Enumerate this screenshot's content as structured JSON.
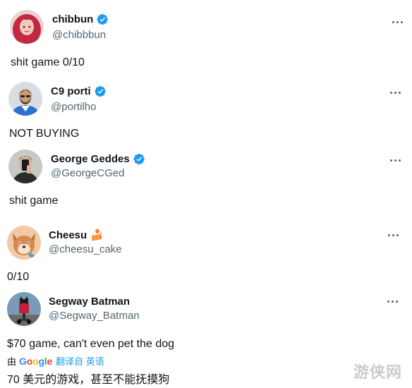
{
  "tweets": [
    {
      "name": "chibbun",
      "handle": "@chibbbun",
      "verified": true,
      "text": "shit game 0/10",
      "avatar_icon": "avatar-pink-hair"
    },
    {
      "name": "C9 porti",
      "handle": "@portilho",
      "verified": true,
      "text": "NOT BUYING",
      "avatar_icon": "avatar-man-jersey"
    },
    {
      "name": "George Geddes",
      "handle": "@GeorgeCGed",
      "verified": true,
      "text": "shit game",
      "avatar_icon": "avatar-mirror-selfie"
    },
    {
      "name": "Cheesu",
      "handle": "@cheesu_cake",
      "verified": false,
      "emoji": "🍰",
      "text": "0/10",
      "avatar_icon": "avatar-cartoon-dog"
    },
    {
      "name": "Segway Batman",
      "handle": "@Segway_Batman",
      "verified": false,
      "text": "$70 game, can't even pet the dog",
      "avatar_icon": "avatar-batman-segway",
      "translation": {
        "by_label": "由",
        "provider": "Google",
        "link_label": "翻译自 英语",
        "translated_text": "70 美元的游戏，甚至不能抚摸狗"
      }
    }
  ],
  "colors": {
    "text": "#0f1419",
    "secondary": "#536471",
    "verified": "#1d9bf0",
    "link": "#1d9bf0"
  },
  "watermark": "游侠网"
}
